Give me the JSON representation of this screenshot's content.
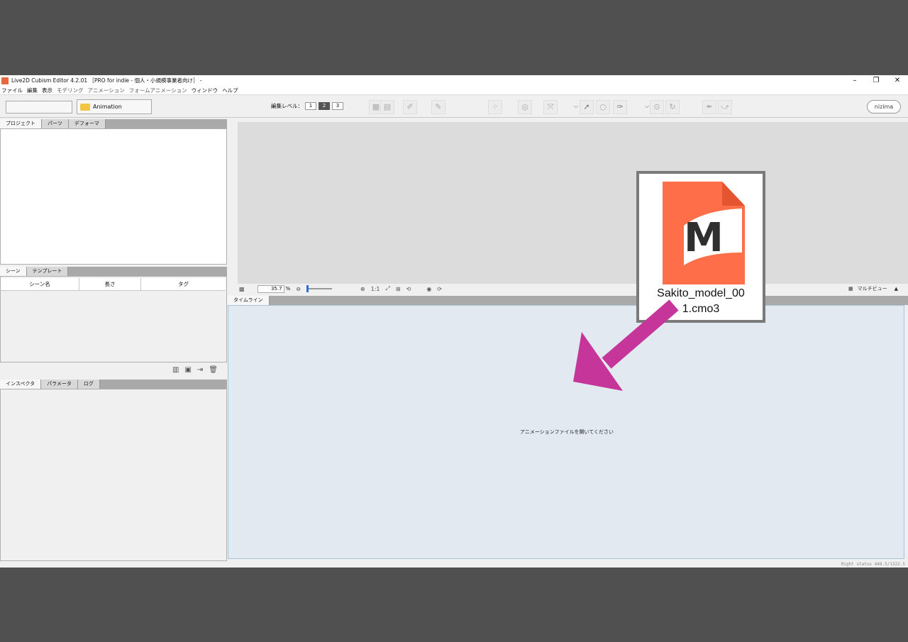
{
  "window": {
    "title": "Live2D Cubism Editor 4.2.01 ［PRO for indie - 個人・小規模事業者向け］ -",
    "controls": [
      "–",
      "❐",
      "✕"
    ]
  },
  "menu": [
    "ファイル",
    "編集",
    "表示",
    "モデリング",
    "アニメーション",
    "フォームアニメーション",
    "ウィンドウ",
    "ヘルプ"
  ],
  "toolbar": {
    "mode_label": "Animation",
    "edit_level_label": "編集レベル：",
    "levels": [
      "1",
      "2",
      "3"
    ],
    "nizima": "nizima"
  },
  "project_panel": {
    "tabs": [
      "プロジェクト",
      "パーツ",
      "デフォーマ"
    ]
  },
  "scene_panel": {
    "tabs": [
      "シーン",
      "テンプレート"
    ],
    "columns": [
      "シーン名",
      "長さ",
      "タグ"
    ]
  },
  "inspector_panel": {
    "tabs": [
      "インスペクタ",
      "パラメータ",
      "ログ"
    ]
  },
  "viewport": {
    "zoom": "35.7",
    "zoom_unit": "%",
    "one_to_one": "1:1",
    "multiview": "マルチビュー"
  },
  "timeline": {
    "tab": "タイムライン",
    "message": "アニメーションファイルを開いてください"
  },
  "status": {
    "text": "Right status  448.5/1322.5"
  },
  "drag_file": {
    "name": "Sakito_model_001.cmo3",
    "icon_letter": "M",
    "icon_color": "#fd6e49"
  },
  "arrow_color": "#c6359a"
}
